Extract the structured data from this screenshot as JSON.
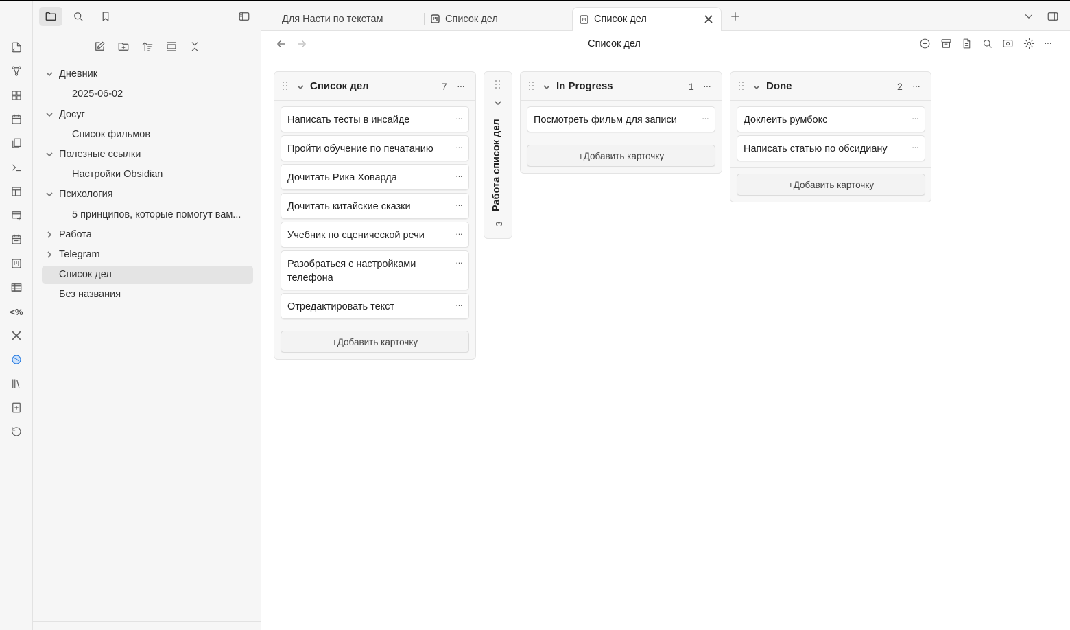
{
  "sidebar": {
    "tree": [
      {
        "label": "Дневник",
        "type": "folder",
        "expanded": true
      },
      {
        "label": "2025-06-02",
        "type": "file"
      },
      {
        "label": "Досуг",
        "type": "folder",
        "expanded": true
      },
      {
        "label": "Список фильмов",
        "type": "file"
      },
      {
        "label": "Полезные ссылки",
        "type": "folder",
        "expanded": true
      },
      {
        "label": "Настройки Obsidian",
        "type": "file"
      },
      {
        "label": "Психология",
        "type": "folder",
        "expanded": true
      },
      {
        "label": "5 принципов, которые помогут вам...",
        "type": "file"
      },
      {
        "label": "Работа",
        "type": "folder",
        "expanded": false
      },
      {
        "label": "Telegram",
        "type": "folder",
        "expanded": false
      },
      {
        "label": "Список дел",
        "type": "file",
        "selected": true
      },
      {
        "label": "Без названия",
        "type": "file"
      }
    ]
  },
  "tabs": [
    {
      "label": "Для Насти по текстам"
    },
    {
      "label": "Список дел"
    },
    {
      "label": "Список дел",
      "active": true
    }
  ],
  "view": {
    "title": "Список дел"
  },
  "board": {
    "lanes": [
      {
        "title": "Список дел",
        "count": "7",
        "cards": [
          "Написать тесты в инсайде",
          "Пройти обучение по печатанию",
          "Дочитать Рика Ховарда",
          "Дочитать китайские сказки",
          "Учебник по сценической речи",
          "Разобраться с настройками телефона",
          "Отредактировать текст"
        ],
        "add_label": "+Добавить карточку"
      },
      {
        "title": "In Progress",
        "count": "1",
        "cards": [
          "Посмотреть фильм для записи"
        ],
        "add_label": "+Добавить карточку"
      },
      {
        "title": "Done",
        "count": "2",
        "cards": [
          "Доклеить румбокс",
          "Написать статью по обсидиану"
        ],
        "add_label": "+Добавить карточку"
      }
    ],
    "collapsed_lane": {
      "title": "Работа список дел",
      "count": "3"
    }
  },
  "colors": {
    "selected_bg": "#e4e4e4",
    "sidebar_bg": "#f6f6f6",
    "lane_bg": "#f7f7f7",
    "accent_globe": "#2b7de0"
  }
}
